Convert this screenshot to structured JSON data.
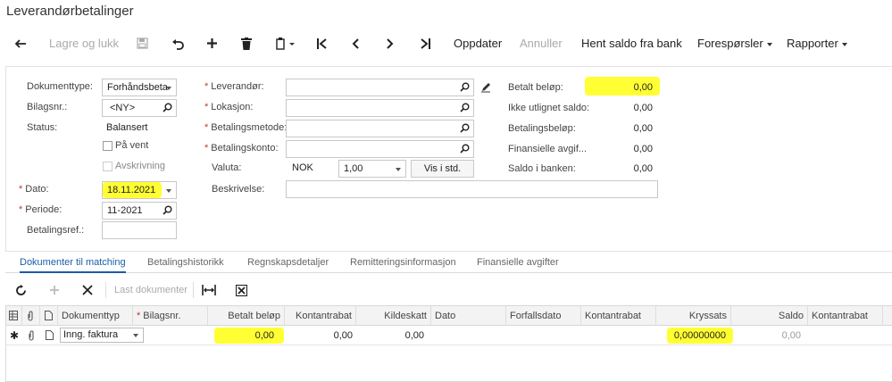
{
  "app": {
    "title": "Leverandørbetalinger"
  },
  "toolbar": {
    "back_icon": "back-arrow-icon",
    "save_close": "Lagre og lukk",
    "save_icon": "save-icon",
    "undo_icon": "undo-icon",
    "add_icon": "plus-icon",
    "delete_icon": "trash-icon",
    "copy_icon": "copy-paste-icon",
    "first_icon": "first-record-icon",
    "prev_icon": "previous-icon",
    "next_icon": "next-icon",
    "last_icon": "last-record-icon",
    "refresh": "Oppdater",
    "cancel": "Annuller",
    "fetch_balance": "Hent saldo fra bank",
    "requests": "Forespørsler",
    "reports": "Rapporter"
  },
  "form": {
    "doc_type": {
      "label": "Dokumenttype:",
      "value": "Forhåndsbeta"
    },
    "doc_no": {
      "label": "Bilagsnr.:",
      "value": "<NY>"
    },
    "status": {
      "label": "Status:",
      "value": "Balansert"
    },
    "on_hold": {
      "label": "På vent",
      "checked": false
    },
    "write_off": {
      "label": "Avskrivning",
      "checked": false
    },
    "date": {
      "label": "Dato:",
      "value": "18.11.2021"
    },
    "period": {
      "label": "Periode:",
      "value": "11-2021"
    },
    "pay_ref": {
      "label": "Betalingsref.:",
      "value": ""
    },
    "vendor": {
      "label": "Leverandør:",
      "value": ""
    },
    "location": {
      "label": "Lokasjon:",
      "value": ""
    },
    "pay_method": {
      "label": "Betalingsmetode:",
      "value": ""
    },
    "pay_account": {
      "label": "Betalingskonto:",
      "value": ""
    },
    "currency": {
      "label": "Valuta:",
      "value": "NOK",
      "rate": "1,00",
      "view_button": "Vis i std."
    },
    "description": {
      "label": "Beskrivelse:",
      "value": ""
    },
    "paid_amount": {
      "label": "Betalt beløp:",
      "value": "0,00"
    },
    "unapplied": {
      "label": "Ikke utlignet saldo:",
      "value": "0,00"
    },
    "payment_amount": {
      "label": "Betalingsbeløp:",
      "value": "0,00"
    },
    "fin_fees": {
      "label": "Finansielle avgif...",
      "value": "0,00"
    },
    "bank_balance": {
      "label": "Saldo i banken:",
      "value": "0,00"
    }
  },
  "tabs": [
    {
      "label": "Dokumenter til matching",
      "active": true
    },
    {
      "label": "Betalingshistorikk",
      "active": false
    },
    {
      "label": "Regnskapsdetaljer",
      "active": false
    },
    {
      "label": "Remitteringsinformasjon",
      "active": false
    },
    {
      "label": "Finansielle avgifter",
      "active": false
    }
  ],
  "grid_toolbar": {
    "refresh_icon": "refresh-icon",
    "add_icon": "plus-icon",
    "delete_icon": "close-icon",
    "load_docs": "Last dokumenter",
    "fit_icon": "fit-columns-icon",
    "export_icon": "excel-export-icon"
  },
  "grid": {
    "columns": [
      "Dokumenttyp",
      "Bilagsnr.",
      "Betalt beløp",
      "Kontantrabat",
      "Kildeskatt",
      "Dato",
      "Forfallsdato",
      "Kontantrabat",
      "Kryssats",
      "Saldo",
      "Kontantrabat"
    ],
    "rows": [
      {
        "doc_type": "Inng. faktura",
        "doc_no": "",
        "paid": "0,00",
        "discount": "0,00",
        "withholding": "0,00",
        "date": "",
        "due_date": "",
        "discount2": "",
        "cross_rate": "0,00000000",
        "balance": "0,00",
        "discount3": ""
      }
    ]
  },
  "colors": {
    "highlight": "#ffff33",
    "accent": "#1a5da8",
    "required": "#c0392b"
  }
}
